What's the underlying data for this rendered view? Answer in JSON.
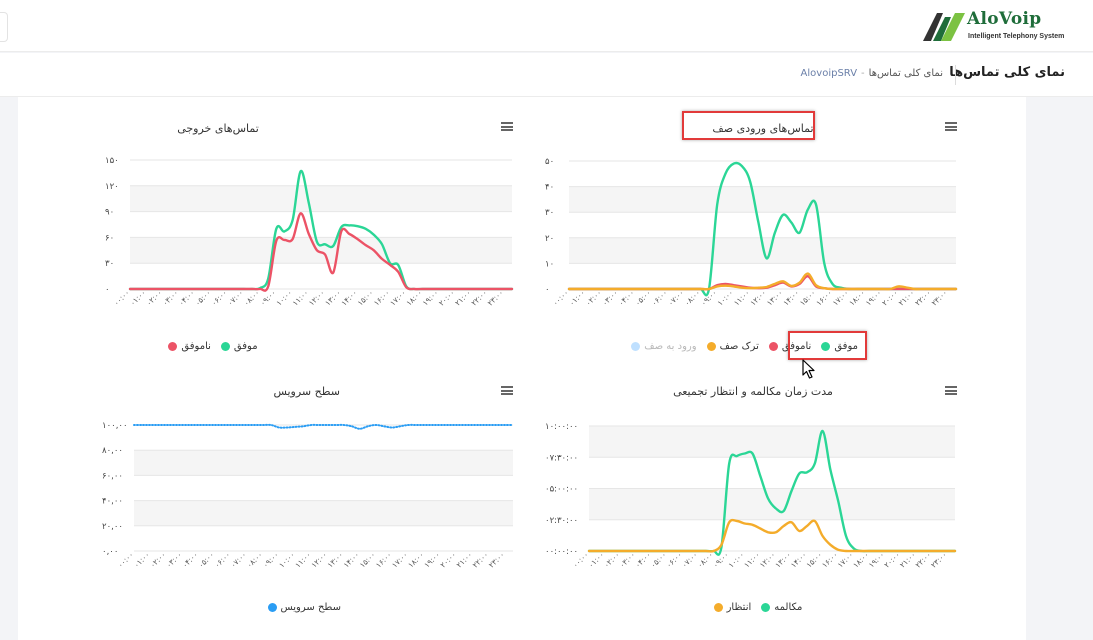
{
  "brand": {
    "name": "AloVoip",
    "tagline": "Intelligent Telephony System",
    "colors": {
      "green": "#1f6d3a",
      "lime": "#7cc242"
    }
  },
  "page": {
    "title": "نمای کلی تماس‌ها",
    "breadcrumb": {
      "home": "AlovoipSRV",
      "sep": "-",
      "current": "نمای کلی تماس‌ها"
    }
  },
  "icons": {
    "menu": "hamburger-icon",
    "cursor": "mouse-pointer-icon"
  },
  "colors": {
    "success": "#2bd696",
    "fail": "#ec5366",
    "abandon": "#f4ac2b",
    "enter": "#bfe0ff",
    "service": "#2a9df4",
    "grid_band": "#f5f5f5"
  },
  "hours": [
    "۰۰:۰۰",
    "۰۱:۰۰",
    "۰۲:۰۰",
    "۰۳:۰۰",
    "۰۴:۰۰",
    "۰۵:۰۰",
    "۰۶:۰۰",
    "۰۷:۰۰",
    "۰۸:۰۰",
    "۰۹:۰۰",
    "۱۰:۰۰",
    "۱۱:۰۰",
    "۱۲:۰۰",
    "۱۳:۰۰",
    "۱۴:۰۰",
    "۱۵:۰۰",
    "۱۶:۰۰",
    "۱۷:۰۰",
    "۱۸:۰۰",
    "۱۹:۰۰",
    "۲۰:۰۰",
    "۲۱:۰۰",
    "۲۲:۰۰",
    "۲۳:۰۰"
  ],
  "chart_data": [
    {
      "id": "outgoing",
      "type": "line",
      "title": "تماس‌های خروجی",
      "ylim": [
        0,
        150
      ],
      "yticks": [
        {
          "v": 0,
          "label": "۰"
        },
        {
          "v": 30,
          "label": "۳۰"
        },
        {
          "v": 60,
          "label": "۶۰"
        },
        {
          "v": 90,
          "label": "۹۰"
        },
        {
          "v": 120,
          "label": "۱۲۰"
        },
        {
          "v": 150,
          "label": "۱۵۰"
        }
      ],
      "x": [
        0,
        0.5,
        1,
        1.5,
        2,
        2.5,
        3,
        3.5,
        4,
        4.5,
        5,
        5.5,
        6,
        6.5,
        7,
        7.5,
        8,
        8.5,
        9,
        9.5,
        10,
        10.5,
        11,
        11.5,
        12,
        12.5,
        13,
        13.5,
        14,
        14.5,
        15,
        15.5,
        16,
        16.5,
        17,
        17.5,
        18,
        18.5,
        19,
        19.5,
        20,
        20.5,
        21,
        21.5,
        22,
        22.5,
        23,
        23.5
      ],
      "series": [
        {
          "name": "موفق",
          "color": "#2bd696",
          "values": [
            0,
            0,
            0,
            0,
            0,
            0,
            0,
            0,
            0,
            0,
            0,
            0,
            0,
            0,
            0,
            0,
            1,
            12,
            70,
            67,
            80,
            137,
            100,
            55,
            52,
            50,
            72,
            74,
            73,
            70,
            63,
            52,
            30,
            28,
            3,
            0,
            0,
            0,
            0,
            0,
            0,
            0,
            0,
            0,
            0,
            0,
            0,
            0
          ]
        },
        {
          "name": "ناموفق",
          "color": "#ec5366",
          "values": [
            0,
            0,
            0,
            0,
            0,
            0,
            0,
            0,
            0,
            0,
            0,
            0,
            0,
            0,
            0,
            0,
            0,
            3,
            56,
            57,
            58,
            88,
            64,
            45,
            40,
            19,
            67,
            64,
            58,
            51,
            45,
            35,
            28,
            20,
            2,
            0,
            0,
            0,
            0,
            0,
            0,
            0,
            0,
            0,
            0,
            0,
            0,
            0
          ]
        }
      ],
      "legend": [
        {
          "name": "موفق",
          "color": "#2bd696"
        },
        {
          "name": "ناموفق",
          "color": "#ec5366"
        }
      ]
    },
    {
      "id": "queue-incoming",
      "type": "line",
      "title": "تماس‌های ورودی صف",
      "ylim": [
        0,
        50
      ],
      "yticks": [
        {
          "v": 0,
          "label": "۰"
        },
        {
          "v": 10,
          "label": "۱۰"
        },
        {
          "v": 20,
          "label": "۲۰"
        },
        {
          "v": 30,
          "label": "۳۰"
        },
        {
          "v": 40,
          "label": "۴۰"
        },
        {
          "v": 50,
          "label": "۵۰"
        }
      ],
      "x": [
        0,
        0.5,
        1,
        1.5,
        2,
        2.5,
        3,
        3.5,
        4,
        4.5,
        5,
        5.5,
        6,
        6.5,
        7,
        7.5,
        8,
        8.5,
        9,
        9.5,
        10,
        10.5,
        11,
        11.5,
        12,
        12.5,
        13,
        13.5,
        14,
        14.5,
        15,
        15.5,
        16,
        16.5,
        17,
        17.5,
        18,
        18.5,
        19,
        19.5,
        20,
        20.5,
        21,
        21.5,
        22,
        22.5,
        23,
        23.5
      ],
      "series": [
        {
          "name": "موفق",
          "color": "#2bd696",
          "values": [
            0,
            0,
            0,
            0,
            0,
            0,
            0,
            0,
            0,
            0,
            0,
            0,
            0,
            0,
            0,
            0,
            0,
            0,
            33,
            45,
            49,
            48,
            42,
            26,
            12,
            22,
            29,
            26,
            22,
            31,
            33,
            10,
            2,
            0.5,
            0,
            0,
            0,
            0,
            0,
            0,
            0,
            0,
            0,
            0,
            0,
            0,
            0,
            0
          ]
        },
        {
          "name": "ناموفق",
          "color": "#ec5366",
          "values": [
            0,
            0,
            0,
            0,
            0,
            0,
            0,
            0,
            0,
            0,
            0,
            0,
            0,
            0,
            0,
            0,
            0,
            0,
            1.5,
            2,
            1.5,
            1,
            0.5,
            0.3,
            0.5,
            1.5,
            2.5,
            1,
            2,
            5,
            1,
            0.3,
            0,
            0,
            0,
            0,
            0,
            0,
            0,
            0,
            0,
            0,
            0,
            0,
            0,
            0,
            0,
            0
          ]
        },
        {
          "name": "ترک صف",
          "color": "#f4ac2b",
          "values": [
            0,
            0,
            0,
            0,
            0,
            0,
            0,
            0,
            0,
            0,
            0,
            0,
            0,
            0,
            0,
            0,
            0,
            0,
            1,
            1.3,
            1,
            0.5,
            0.3,
            0.5,
            0.8,
            2,
            3,
            1.2,
            2.5,
            6,
            1.5,
            0.3,
            0,
            0,
            0,
            0,
            0,
            0,
            0,
            0,
            1,
            0.6,
            0,
            0,
            0,
            0,
            0,
            0
          ]
        }
      ],
      "legend": [
        {
          "name": "موفق",
          "color": "#2bd696"
        },
        {
          "name": "ناموفق",
          "color": "#ec5366"
        },
        {
          "name": "ترک صف",
          "color": "#f4ac2b"
        },
        {
          "name": "ورود به صف",
          "color": "#bfe0ff",
          "hidden": true
        }
      ]
    },
    {
      "id": "service-level",
      "type": "line",
      "title": "سطح سرویس",
      "ylim": [
        0,
        100
      ],
      "yticks": [
        {
          "v": 0,
          "label": "۰,۰۰"
        },
        {
          "v": 20,
          "label": "۲۰,۰۰"
        },
        {
          "v": 40,
          "label": "۴۰,۰۰"
        },
        {
          "v": 60,
          "label": "۶۰,۰۰"
        },
        {
          "v": 80,
          "label": "۸۰,۰۰"
        },
        {
          "v": 100,
          "label": "۱۰۰,۰۰"
        }
      ],
      "x": [
        0,
        0.5,
        1,
        1.5,
        2,
        2.5,
        3,
        3.5,
        4,
        4.5,
        5,
        5.5,
        6,
        6.5,
        7,
        7.5,
        8,
        8.5,
        9,
        9.5,
        10,
        10.5,
        11,
        11.5,
        12,
        12.5,
        13,
        13.5,
        14,
        14.5,
        15,
        15.5,
        16,
        16.5,
        17,
        17.5,
        18,
        18.5,
        19,
        19.5,
        20,
        20.5,
        21,
        21.5,
        22,
        22.5,
        23,
        23.5
      ],
      "series": [
        {
          "name": "سطح سرویس",
          "color": "#2a9df4",
          "dotted": true,
          "values": [
            100,
            100,
            100,
            100,
            100,
            100,
            100,
            100,
            100,
            100,
            100,
            100,
            100,
            100,
            100,
            100,
            100,
            100,
            98,
            98,
            98.5,
            99,
            100,
            100,
            100,
            100,
            100,
            99,
            97,
            99,
            100,
            99,
            98,
            99,
            100,
            100,
            100,
            100,
            100,
            100,
            100,
            100,
            100,
            100,
            100,
            100,
            100,
            100
          ]
        }
      ],
      "legend": [
        {
          "name": "سطح سرویس",
          "color": "#2a9df4"
        }
      ]
    },
    {
      "id": "durations",
      "type": "line",
      "title": "مدت زمان مکالمه و انتظار تجمیعی",
      "ylim": [
        0,
        10
      ],
      "yticks": [
        {
          "v": 0,
          "label": "۰۰:۰۰:۰۰"
        },
        {
          "v": 2.5,
          "label": "۰۲:۳۰:۰۰"
        },
        {
          "v": 5,
          "label": "۰۵:۰۰:۰۰"
        },
        {
          "v": 7.5,
          "label": "۰۷:۳۰:۰۰"
        },
        {
          "v": 10,
          "label": "۱۰:۰۰:۰۰"
        }
      ],
      "x": [
        0,
        0.5,
        1,
        1.5,
        2,
        2.5,
        3,
        3.5,
        4,
        4.5,
        5,
        5.5,
        6,
        6.5,
        7,
        7.5,
        8,
        8.5,
        9,
        9.5,
        10,
        10.5,
        11,
        11.5,
        12,
        12.5,
        13,
        13.5,
        14,
        14.5,
        15,
        15.5,
        16,
        16.5,
        17,
        17.5,
        18,
        18.5,
        19,
        19.5,
        20,
        20.5,
        21,
        21.5,
        22,
        22.5,
        23,
        23.5
      ],
      "series": [
        {
          "name": "مکالمه",
          "color": "#2bd696",
          "values": [
            0,
            0,
            0,
            0,
            0,
            0,
            0,
            0,
            0,
            0,
            0,
            0,
            0,
            0,
            0,
            0,
            0,
            0.3,
            7,
            7.6,
            7.8,
            7.8,
            6,
            4.2,
            3.4,
            3.2,
            4.8,
            6.2,
            6.3,
            7,
            9.6,
            6.5,
            4,
            1.2,
            0.2,
            0,
            0,
            0,
            0,
            0,
            0,
            0,
            0,
            0,
            0,
            0,
            0,
            0
          ]
        },
        {
          "name": "انتظار",
          "color": "#f4ac2b",
          "values": [
            0,
            0,
            0,
            0,
            0,
            0,
            0,
            0,
            0,
            0,
            0,
            0,
            0,
            0,
            0,
            0,
            0,
            0.5,
            2.3,
            2.4,
            2.2,
            2.1,
            1.8,
            1.5,
            1.5,
            2,
            2.3,
            1.6,
            2,
            2.4,
            1.2,
            0.5,
            0.1,
            0,
            0,
            0,
            0,
            0,
            0,
            0,
            0,
            0,
            0,
            0,
            0,
            0,
            0,
            0
          ]
        }
      ],
      "legend": [
        {
          "name": "مکالمه",
          "color": "#2bd696"
        },
        {
          "name": "انتظار",
          "color": "#f4ac2b"
        }
      ]
    }
  ]
}
